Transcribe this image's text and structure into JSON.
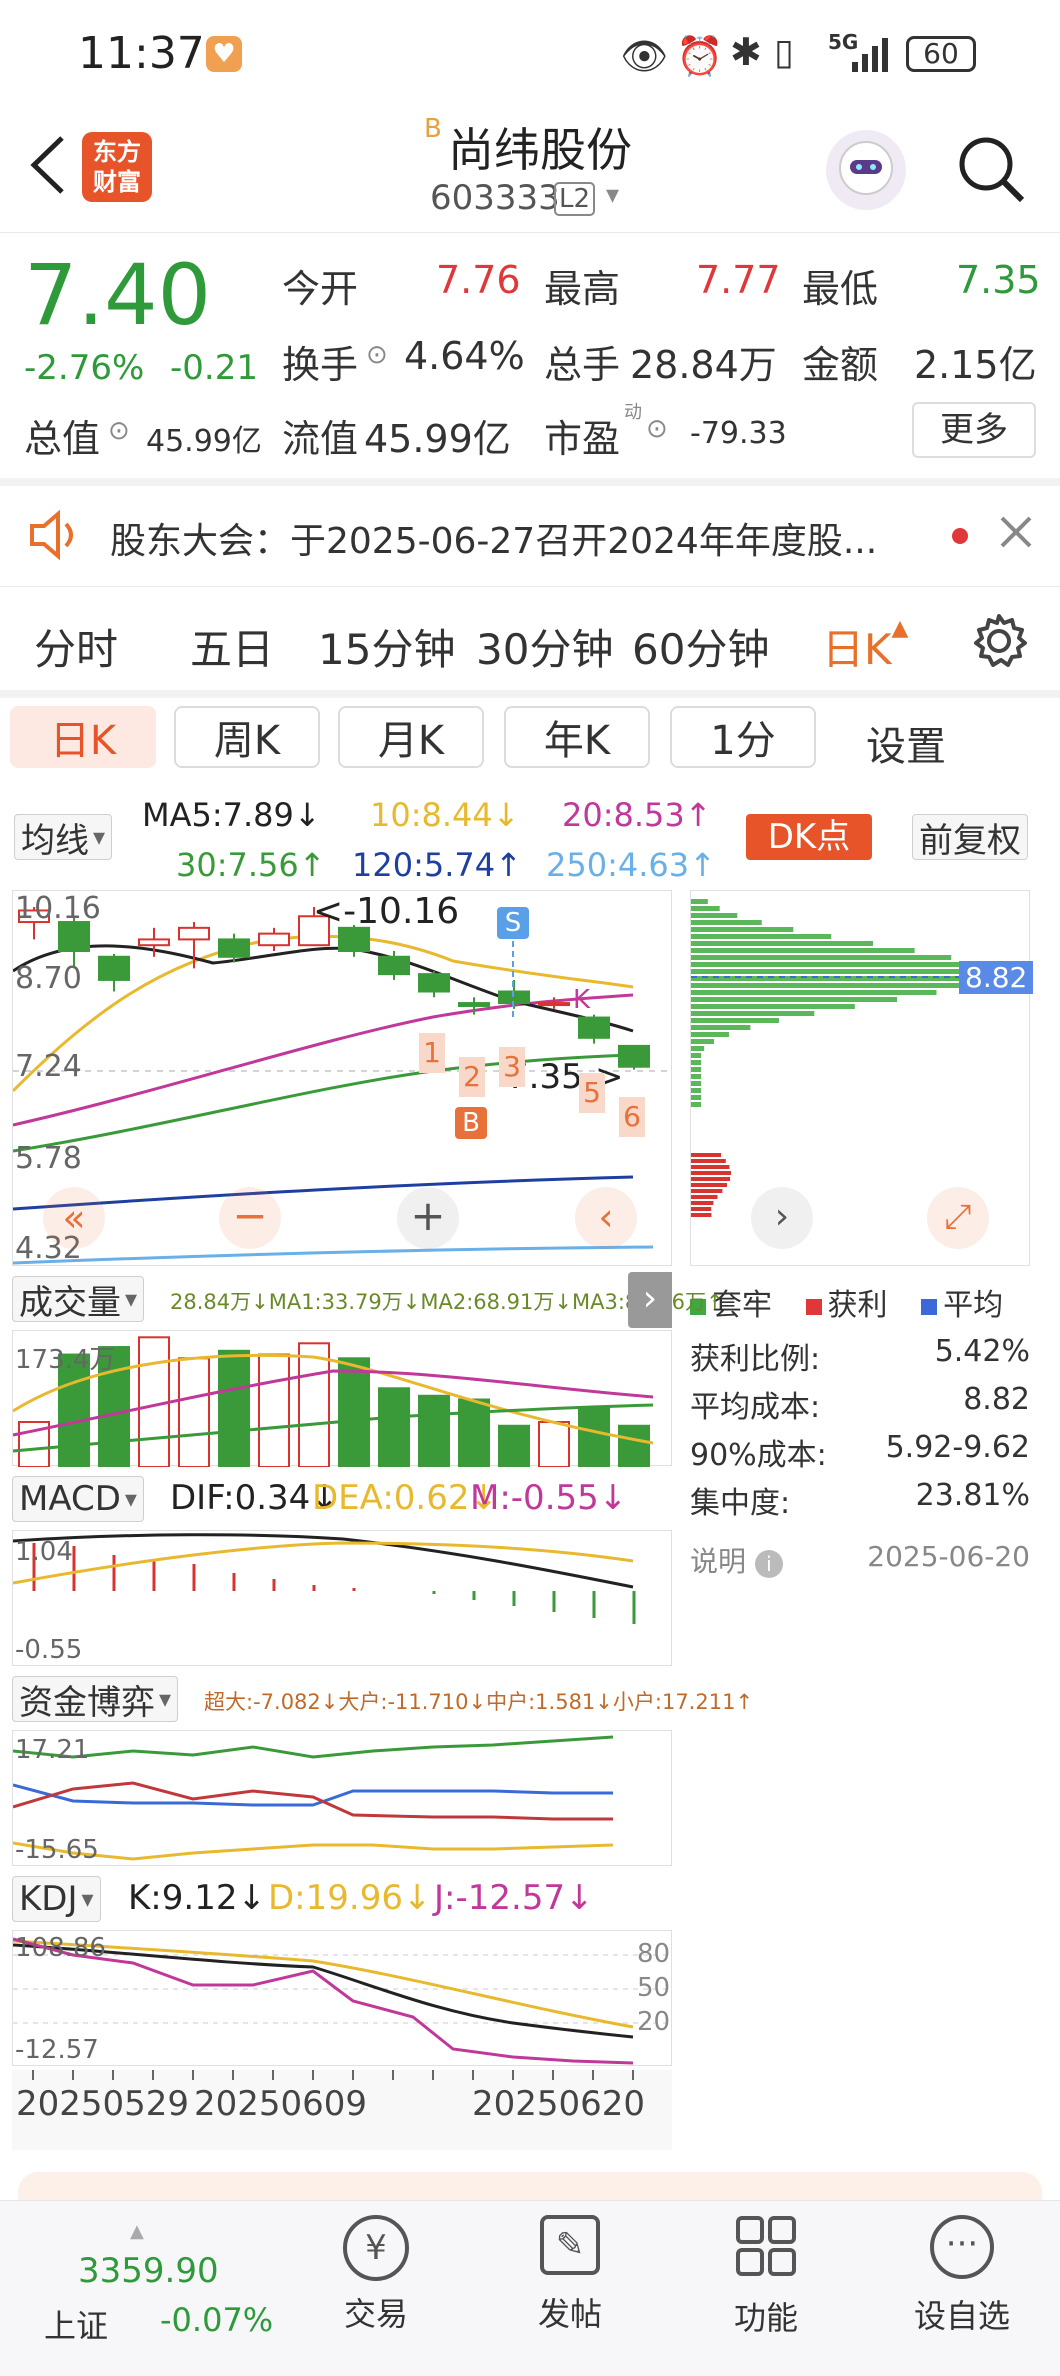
{
  "status": {
    "time": "11:37",
    "battery": "60",
    "net": "5G"
  },
  "header": {
    "logo_line1": "东方",
    "logo_line2": "财富",
    "badge": "B",
    "name": "尚纬股份",
    "code": "603333",
    "level": "L2"
  },
  "quote": {
    "price": "7.40",
    "pct": "-2.76%",
    "chg": "-0.21",
    "open_label": "今开",
    "open": "7.76",
    "high_label": "最高",
    "high": "7.77",
    "low_label": "最低",
    "low": "7.35",
    "turnover_label": "换手",
    "turnover": "4.64%",
    "vol_label": "总手",
    "vol": "28.84万",
    "amount_label": "金额",
    "amount": "2.15亿",
    "mcap_label": "总值",
    "mcap": "45.99亿",
    "float_label": "流值",
    "float": "45.99亿",
    "pe_label": "市盈",
    "pe_sup": "动",
    "pe": "-79.33",
    "more": "更多"
  },
  "notice": {
    "text": "股东大会：于2025-06-27召开2024年年度股..."
  },
  "period_tabs": [
    "分时",
    "五日",
    "15分钟",
    "30分钟",
    "60分钟",
    "日K"
  ],
  "sub_tabs": [
    "日K",
    "周K",
    "月K",
    "年K",
    "1分",
    "设置"
  ],
  "ma": {
    "selector": "均线",
    "ma5": "MA5:7.89↓",
    "ma10": "10:8.44↓",
    "ma20": "20:8.53↑",
    "ma30": "30:7.56↑",
    "ma120": "120:5.74↑",
    "ma250": "250:4.63↑",
    "dk": "DK点",
    "adjust": "前复权",
    "colors": {
      "ma5": "#222222",
      "ma10": "#e8b92e",
      "ma20": "#c0389a",
      "ma30": "#3a9a3a",
      "ma120": "#1f3fa0",
      "ma250": "#6ab0e8"
    }
  },
  "kchart": {
    "y_labels": [
      "10.16",
      "8.70",
      "7.24",
      "5.78",
      "4.32"
    ],
    "high_note": "<-10.16",
    "low_note": "7.35->",
    "marks": [
      "1",
      "2",
      "3",
      "5",
      "6"
    ],
    "s_mark": "S",
    "b_mark": "B",
    "k_mark": "K",
    "candles": [
      {
        "o": 9.9,
        "c": 10.1,
        "h": 10.16,
        "l": 9.6
      },
      {
        "o": 9.9,
        "c": 9.4,
        "h": 10.0,
        "l": 9.1
      },
      {
        "o": 9.3,
        "c": 8.9,
        "h": 9.35,
        "l": 8.7
      },
      {
        "o": 9.5,
        "c": 9.6,
        "h": 9.8,
        "l": 9.3
      },
      {
        "o": 9.6,
        "c": 9.8,
        "h": 9.9,
        "l": 9.1
      },
      {
        "o": 9.6,
        "c": 9.3,
        "h": 9.7,
        "l": 9.2
      },
      {
        "o": 9.5,
        "c": 9.7,
        "h": 9.8,
        "l": 9.4
      },
      {
        "o": 9.5,
        "c": 10.0,
        "h": 10.16,
        "l": 9.5
      },
      {
        "o": 9.8,
        "c": 9.4,
        "h": 9.85,
        "l": 9.3
      },
      {
        "o": 9.3,
        "c": 9.0,
        "h": 9.4,
        "l": 8.9
      },
      {
        "o": 9.0,
        "c": 8.7,
        "h": 9.05,
        "l": 8.6
      },
      {
        "o": 8.5,
        "c": 8.45,
        "h": 8.6,
        "l": 8.3
      },
      {
        "o": 8.7,
        "c": 8.5,
        "h": 8.9,
        "l": 8.4
      },
      {
        "o": 8.5,
        "c": 8.5,
        "h": 8.6,
        "l": 8.4
      },
      {
        "o": 8.25,
        "c": 7.9,
        "h": 8.3,
        "l": 7.8
      },
      {
        "o": 7.76,
        "c": 7.4,
        "h": 7.77,
        "l": 7.35
      }
    ]
  },
  "chip": {
    "avg": "8.82",
    "legend": [
      "套牢",
      "获利",
      "平均"
    ],
    "rows": [
      {
        "k": "获利比例:",
        "v": "5.42%"
      },
      {
        "k": "平均成本:",
        "v": "8.82"
      },
      {
        "k": "90%成本:",
        "v": "5.92-9.62"
      },
      {
        "k": "集中度:",
        "v": "23.81%"
      }
    ],
    "note": "说明",
    "date": "2025-06-20"
  },
  "volume": {
    "selector": "成交量",
    "line": "28.84万↓MA1:33.79万↓MA2:68.91万↓MA3:81.56万↑",
    "top": "173.4万",
    "vals": [
      60,
      150,
      160,
      173,
      145,
      155,
      150,
      165,
      145,
      105,
      95,
      90,
      55,
      60,
      80,
      55
    ]
  },
  "macd": {
    "selector": "MACD",
    "dif": "DIF:0.34↓",
    "dea": "DEA:0.62↓",
    "m": "M:-0.55↓",
    "top": "1.04",
    "bottom": "-0.55"
  },
  "fund": {
    "selector": "资金博弈",
    "line": "超大:-7.082↓大户:-11.710↓中户:1.581↓小户:17.211↑",
    "top": "17.21",
    "bottom": "-15.65"
  },
  "kdj": {
    "selector": "KDJ",
    "k": "K:9.12↓",
    "d": "D:19.96↓",
    "j": "J:-12.57↓",
    "top": "108.86",
    "bottom": "-12.57",
    "levels": [
      "80",
      "50",
      "20"
    ]
  },
  "dates": [
    "20250529",
    "20250609",
    "20250620"
  ],
  "nav": {
    "index_value": "3359.90",
    "index_name": "上证",
    "index_chg": "-0.07%",
    "items": [
      "交易",
      "发帖",
      "功能",
      "设自选"
    ]
  }
}
